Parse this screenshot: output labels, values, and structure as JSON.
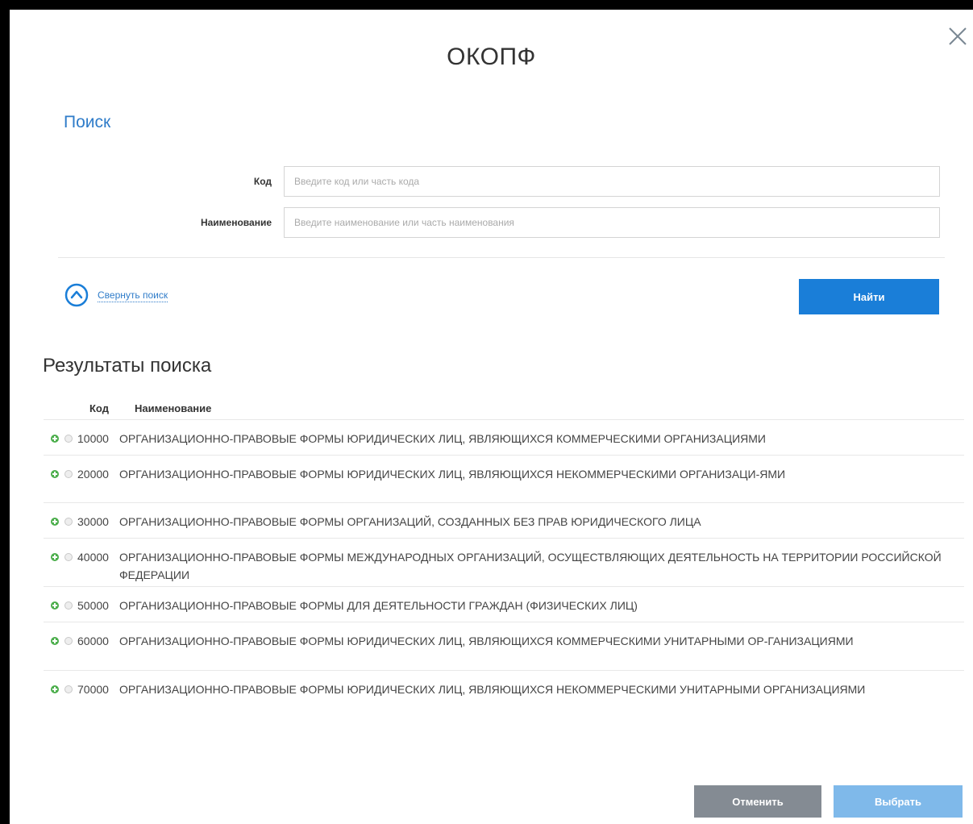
{
  "dialog": {
    "title": "ОКОПФ"
  },
  "search": {
    "section_title": "Поиск",
    "code_label": "Код",
    "code_placeholder": "Введите код или часть кода",
    "name_label": "Наименование",
    "name_placeholder": "Введите наименование или часть наименования",
    "collapse_label": "Свернуть поиск",
    "find_button": "Найти"
  },
  "results": {
    "title": "Результаты поиска",
    "columns": {
      "code": "Код",
      "name": "Наименование"
    },
    "rows": [
      {
        "code": "10000",
        "name": "ОРГАНИЗАЦИОННО-ПРАВОВЫЕ ФОРМЫ ЮРИДИЧЕСКИХ ЛИЦ, ЯВЛЯЮЩИХСЯ КОММЕРЧЕСКИМИ ОРГАНИЗАЦИЯМИ"
      },
      {
        "code": "20000",
        "name": "ОРГАНИЗАЦИОННО-ПРАВОВЫЕ ФОРМЫ ЮРИДИЧЕСКИХ ЛИЦ, ЯВЛЯЮЩИХСЯ НЕКОММЕРЧЕСКИМИ ОРГАНИЗАЦИ-ЯМИ"
      },
      {
        "code": "30000",
        "name": "ОРГАНИЗАЦИОННО-ПРАВОВЫЕ ФОРМЫ ОРГАНИЗАЦИЙ, СОЗДАННЫХ БЕЗ ПРАВ ЮРИДИЧЕСКОГО ЛИЦА"
      },
      {
        "code": "40000",
        "name": "ОРГАНИЗАЦИОННО-ПРАВОВЫЕ ФОРМЫ МЕЖДУНАРОДНЫХ ОРГАНИЗАЦИЙ, ОСУЩЕСТВЛЯЮЩИХ ДЕЯТЕЛЬНОСТЬ НА ТЕРРИТОРИИ РОССИЙСКОЙ ФЕДЕРАЦИИ"
      },
      {
        "code": "50000",
        "name": "ОРГАНИЗАЦИОННО-ПРАВОВЫЕ ФОРМЫ ДЛЯ ДЕЯТЕЛЬНОСТИ ГРАЖДАН (ФИЗИЧЕСКИХ ЛИЦ)"
      },
      {
        "code": "60000",
        "name": "ОРГАНИЗАЦИОННО-ПРАВОВЫЕ ФОРМЫ ЮРИДИЧЕСКИХ ЛИЦ, ЯВЛЯЮЩИХСЯ КОММЕРЧЕСКИМИ УНИТАРНЫМИ ОР-ГАНИЗАЦИЯМИ"
      },
      {
        "code": "70000",
        "name": "ОРГАНИЗАЦИОННО-ПРАВОВЫЕ ФОРМЫ ЮРИДИЧЕСКИХ ЛИЦ, ЯВЛЯЮЩИХСЯ НЕКОММЕРЧЕСКИМИ УНИТАРНЫМИ ОРГАНИЗАЦИЯМИ"
      }
    ]
  },
  "footer": {
    "cancel_button": "Отменить",
    "select_button": "Выбрать"
  },
  "colors": {
    "accent": "#1a7ed8",
    "link": "#2f7cc9",
    "expand": "#4cae4c",
    "cancel": "#848b93",
    "select_disabled": "#7fb9ea"
  },
  "icons": {
    "close": "close-icon",
    "collapse": "chevron-up-circle-icon",
    "expand": "plus-circle-icon"
  }
}
